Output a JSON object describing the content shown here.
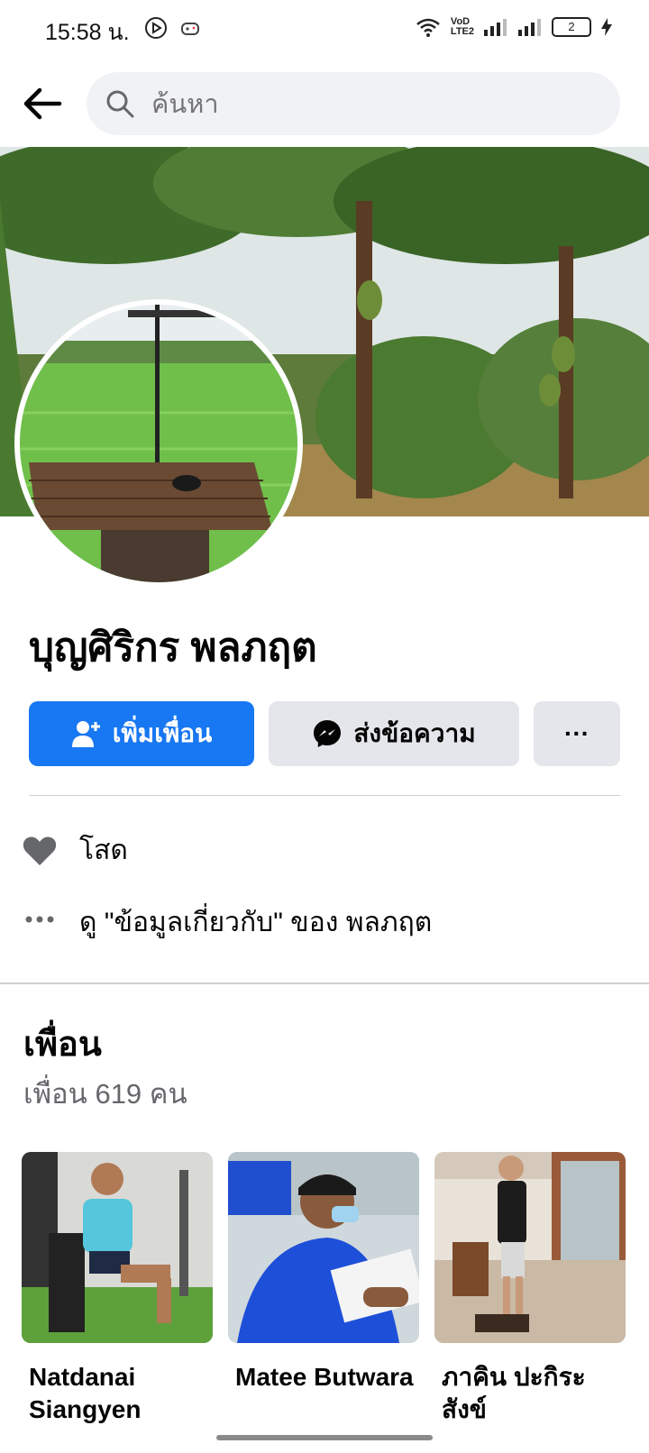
{
  "status_bar": {
    "time": "15:58 น.",
    "volte_top": "VoD",
    "volte_bottom": "LTE2",
    "battery": "2"
  },
  "search": {
    "placeholder": "ค้นหา"
  },
  "profile": {
    "name": "บุญศิริกร พลภฤต"
  },
  "actions": {
    "add_friend_label": "เพิ่มเพื่อน",
    "message_label": "ส่งข้อความ",
    "more_label": "···"
  },
  "intro": {
    "relationship": "โสด",
    "about_link": "ดู \"ข้อมูลเกี่ยวกับ\" ของ พลภฤต"
  },
  "friends": {
    "title": "เพื่อน",
    "count": "เพื่อน 619 คน",
    "items": [
      {
        "name": "Natdanai Siangyen"
      },
      {
        "name": "Matee Butwara"
      },
      {
        "name": "ภาคิน ปะกิระสังข์"
      }
    ]
  },
  "colors": {
    "accent": "#1877f2",
    "secondary_button": "#e4e6eb",
    "search_bg": "#f0f2f5",
    "muted_text": "#65676b"
  }
}
